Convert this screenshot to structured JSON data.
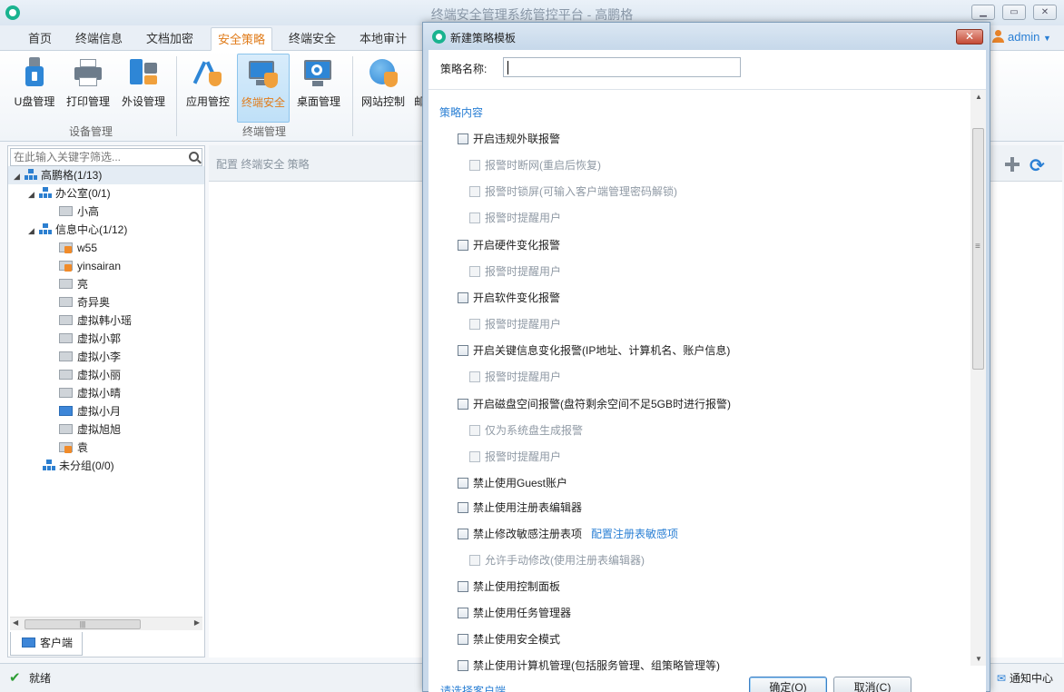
{
  "window": {
    "title": "终端安全管理系统管控平台 - 高鹏格"
  },
  "tabs": [
    "首页",
    "终端信息",
    "文档加密",
    "安全策略",
    "终端安全",
    "本地审计"
  ],
  "active_tab": "安全策略",
  "user": {
    "name": "admin"
  },
  "ribbon": {
    "buttons": [
      {
        "label": "U盘管理",
        "icon": "usb-icon"
      },
      {
        "label": "打印管理",
        "icon": "printer-icon"
      },
      {
        "label": "外设管理",
        "icon": "peripheral-icon"
      },
      {
        "label": "应用管控",
        "icon": "app-control-icon"
      },
      {
        "label": "终端安全",
        "icon": "terminal-security-icon"
      },
      {
        "label": "桌面管理",
        "icon": "desktop-icon"
      },
      {
        "label": "网站控制",
        "icon": "globe-icon"
      },
      {
        "label": "邮",
        "icon": "mail-icon"
      }
    ],
    "groups": [
      "设备管理",
      "终端管理"
    ]
  },
  "sidebar": {
    "search_placeholder": "在此输入关键字筛选...",
    "tree": [
      {
        "label": "高鹏格(1/13)",
        "type": "org"
      },
      {
        "label": "办公室(0/1)",
        "type": "org"
      },
      {
        "label": "小高",
        "type": "pc"
      },
      {
        "label": "信息中心(1/12)",
        "type": "org"
      },
      {
        "label": "w55",
        "type": "pc-lock"
      },
      {
        "label": "yinsairan",
        "type": "pc-lock"
      },
      {
        "label": "亮",
        "type": "pc"
      },
      {
        "label": "奇异奥",
        "type": "pc"
      },
      {
        "label": "虚拟韩小瑶",
        "type": "pc"
      },
      {
        "label": "虚拟小郭",
        "type": "pc"
      },
      {
        "label": "虚拟小李",
        "type": "pc"
      },
      {
        "label": "虚拟小丽",
        "type": "pc"
      },
      {
        "label": "虚拟小晴",
        "type": "pc"
      },
      {
        "label": "虚拟小月",
        "type": "pc-online"
      },
      {
        "label": "虚拟旭旭",
        "type": "pc"
      },
      {
        "label": "袁",
        "type": "pc-lock"
      },
      {
        "label": "未分组(0/0)",
        "type": "org"
      }
    ],
    "bottom_tab": "客户端"
  },
  "breadcrumb": "配置 终端安全 策略",
  "status": {
    "text": "就绪",
    "notify": "通知中心"
  },
  "dialog": {
    "title": "新建策略模板",
    "name_label": "策略名称:",
    "name_value": "",
    "section_title": "策略内容",
    "options": [
      {
        "label": "开启违规外联报警",
        "sub": false
      },
      {
        "label": "报警时断网(重启后恢复)",
        "sub": true
      },
      {
        "label": "报警时锁屏(可输入客户端管理密码解锁)",
        "sub": true
      },
      {
        "label": "报警时提醒用户",
        "sub": true
      },
      {
        "label": "开启硬件变化报警",
        "sub": false
      },
      {
        "label": "报警时提醒用户",
        "sub": true
      },
      {
        "label": "开启软件变化报警",
        "sub": false
      },
      {
        "label": "报警时提醒用户",
        "sub": true
      },
      {
        "label": "开启关键信息变化报警(IP地址、计算机名、账户信息)",
        "sub": false
      },
      {
        "label": "报警时提醒用户",
        "sub": true
      },
      {
        "label": "开启磁盘空间报警(盘符剩余空间不足5GB时进行报警)",
        "sub": false
      },
      {
        "label": "仅为系统盘生成报警",
        "sub": true
      },
      {
        "label": "报警时提醒用户",
        "sub": true
      },
      {
        "label": "禁止使用Guest账户",
        "sub": false
      },
      {
        "label": "禁止使用注册表编辑器",
        "sub": false
      },
      {
        "label": "禁止修改敏感注册表项",
        "sub": false,
        "link": "配置注册表敏感项"
      },
      {
        "label": "允许手动修改(使用注册表编辑器)",
        "sub": true
      },
      {
        "label": "禁止使用控制面板",
        "sub": false
      },
      {
        "label": "禁止使用任务管理器",
        "sub": false
      },
      {
        "label": "禁止使用安全模式",
        "sub": false
      },
      {
        "label": "禁止使用计算机管理(包括服务管理、组策略管理等)",
        "sub": false
      }
    ],
    "select_link": "请选择客户端",
    "ok_label": "确定(O)",
    "cancel_label": "取消(C)"
  }
}
